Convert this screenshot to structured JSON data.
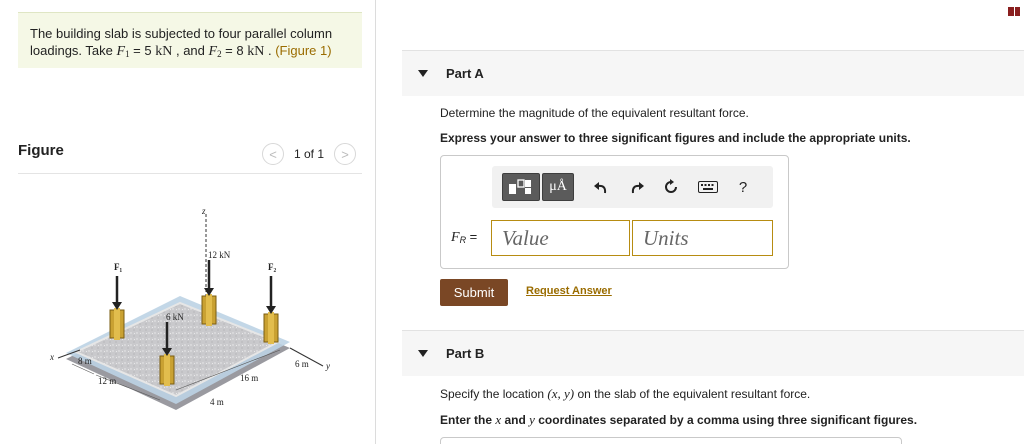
{
  "problem": {
    "intro": "The building slab is subjected to four parallel column loadings. Take ",
    "f1_var": "F",
    "f1_sub": "1",
    "f1_eq": " = 5 ",
    "f1_unit": "kN",
    "sep": " , and ",
    "f2_var": "F",
    "f2_sub": "2",
    "f2_eq": " = 8 ",
    "f2_unit": "kN",
    "period": " . ",
    "figure_link": "(Figure 1)"
  },
  "figure": {
    "title": "Figure",
    "count": "1 of 1",
    "prev_icon": "<",
    "next_icon": ">",
    "labels": {
      "z": "z",
      "x": "x",
      "y": "y",
      "f1": "F₁",
      "f2": "F₂",
      "load_12": "12 kN",
      "load_6": "6 kN",
      "dim_8": "8 m",
      "dim_12": "12 m",
      "dim_16": "16 m",
      "dim_6": "6 m",
      "dim_4": "4 m"
    }
  },
  "part_a": {
    "label": "Part A",
    "question": "Determine the magnitude of the equivalent resultant force.",
    "instruction": "Express your answer to three significant figures and include the appropriate units.",
    "answer_var": "F",
    "answer_sub": "R",
    "answer_eq": " =",
    "value_placeholder": "Value",
    "units_placeholder": "Units",
    "toolbar": {
      "template_icon": "template-icon",
      "units_label": "μÅ",
      "undo_icon": "undo-icon",
      "redo_icon": "redo-icon",
      "reset_icon": "reset-icon",
      "keyboard_icon": "keyboard-icon",
      "help_label": "?"
    },
    "submit_label": "Submit",
    "request_answer_label": "Request Answer"
  },
  "part_b": {
    "label": "Part B",
    "question_pre": "Specify the location ",
    "question_math": "(x, y)",
    "question_post": " on the slab of the equivalent resultant force.",
    "instruction_pre": "Enter the ",
    "instruction_x": "x",
    "instruction_mid": " and ",
    "instruction_y": "y",
    "instruction_post": " coordinates separated by a comma using three significant figures."
  },
  "colors": {
    "accent_link": "#9a6c00",
    "submit_bg": "#7a4725",
    "input_border": "#b78c12",
    "problem_bg": "#f5f8e6"
  }
}
